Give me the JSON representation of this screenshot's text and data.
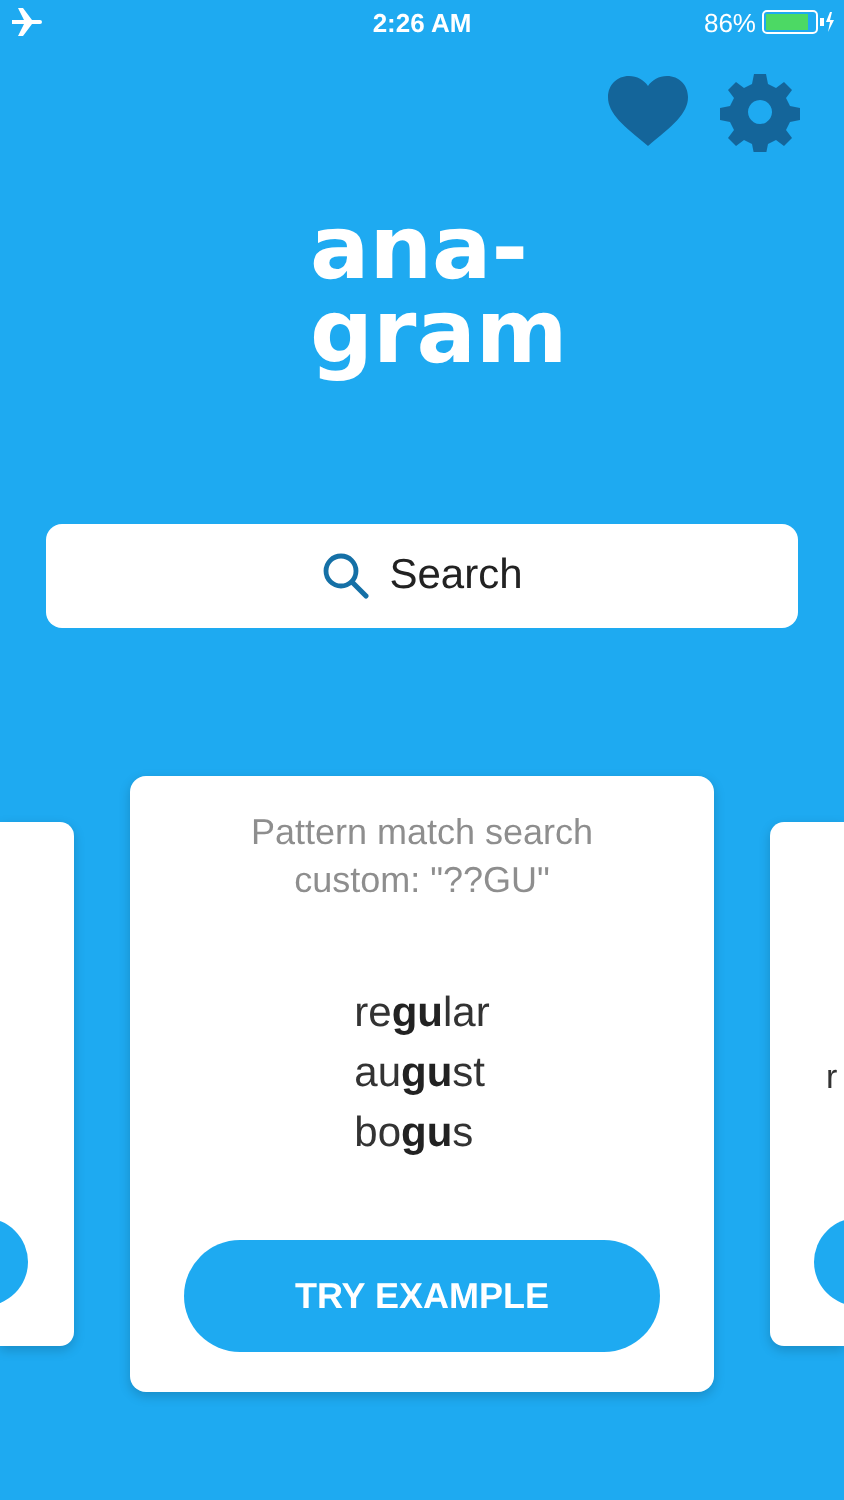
{
  "status_bar": {
    "time": "2:26 AM",
    "battery": "86%"
  },
  "title": [
    "ana-",
    "gram"
  ],
  "search": {
    "label": "Search"
  },
  "cards": [
    {
      "kind": "peek-left"
    },
    {
      "kind": "full",
      "title": "Pattern match search custom: \"??GU\"",
      "words": [
        "re**gu**lar",
        "au**gu**st",
        "bo**gu**s"
      ],
      "button": "TRY EXAMPLE"
    },
    {
      "kind": "peek-right",
      "text": "r"
    }
  ]
}
